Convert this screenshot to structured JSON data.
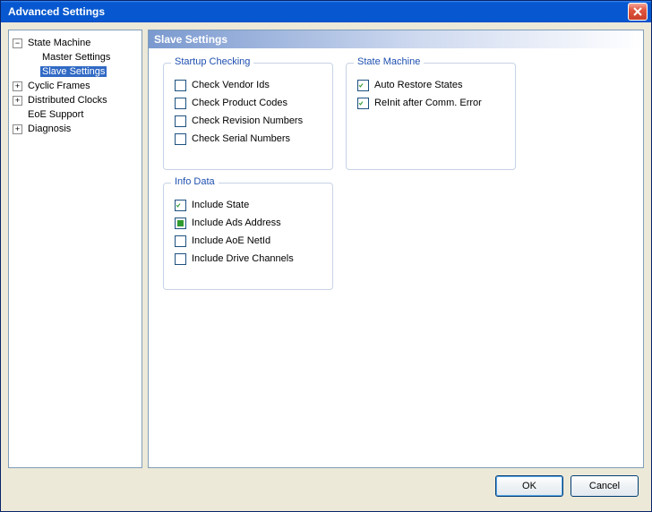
{
  "window": {
    "title": "Advanced Settings"
  },
  "tree": {
    "state_machine": {
      "label": "State Machine",
      "expander": "−"
    },
    "master_settings": {
      "label": "Master Settings"
    },
    "slave_settings": {
      "label": "Slave Settings"
    },
    "cyclic_frames": {
      "label": "Cyclic Frames",
      "expander": "+"
    },
    "distributed_clocks": {
      "label": "Distributed Clocks",
      "expander": "+"
    },
    "eoe_support": {
      "label": "EoE Support"
    },
    "diagnosis": {
      "label": "Diagnosis",
      "expander": "+"
    }
  },
  "section": {
    "title": "Slave Settings"
  },
  "groups": {
    "startup": {
      "title": "Startup Checking",
      "vendor": "Check Vendor Ids",
      "product": "Check Product Codes",
      "revision": "Check Revision Numbers",
      "serial": "Check Serial Numbers"
    },
    "state_machine": {
      "title": "State Machine",
      "auto_restore": "Auto Restore States",
      "reinit": "ReInit after Comm. Error"
    },
    "info": {
      "title": "Info Data",
      "state": "Include State",
      "ads": "Include Ads Address",
      "aoe": "Include AoE NetId",
      "drive": "Include Drive Channels"
    }
  },
  "buttons": {
    "ok": "OK",
    "cancel": "Cancel"
  },
  "checks": {
    "vendor": false,
    "product": false,
    "revision": false,
    "serial": false,
    "auto_restore": true,
    "reinit": true,
    "state": true,
    "ads": "square",
    "aoe": false,
    "drive": false
  }
}
